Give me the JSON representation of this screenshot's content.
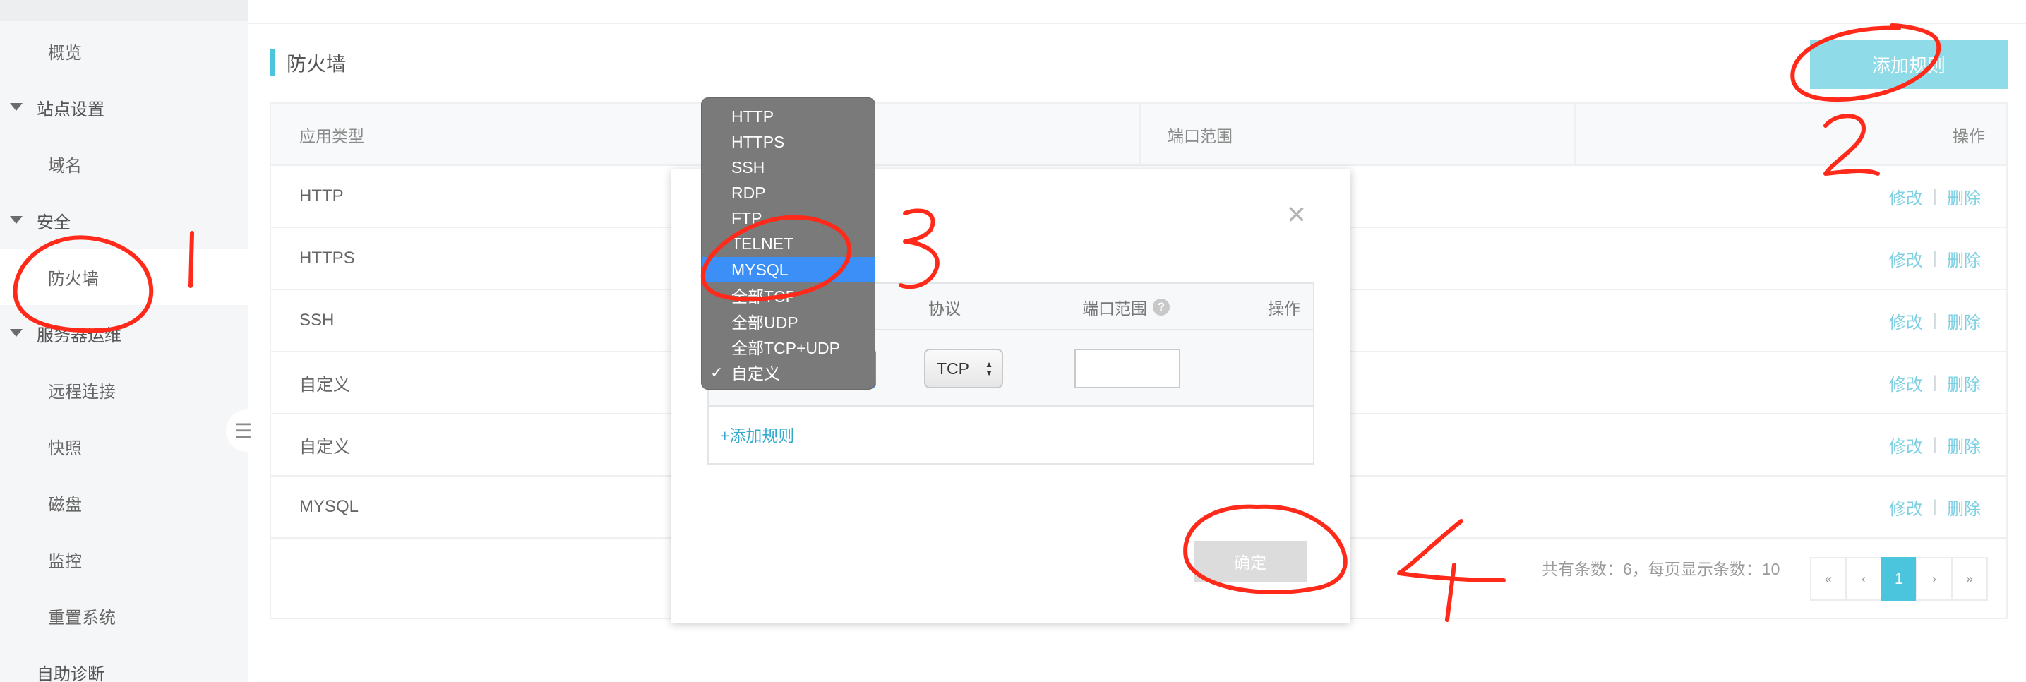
{
  "sidebar": {
    "items": [
      {
        "label": "概览"
      },
      {
        "label": "站点设置"
      },
      {
        "label": "域名"
      },
      {
        "label": "安全"
      },
      {
        "label": "防火墙"
      },
      {
        "label": "服务器运维"
      },
      {
        "label": "远程连接"
      },
      {
        "label": "快照"
      },
      {
        "label": "磁盘"
      },
      {
        "label": "监控"
      },
      {
        "label": "重置系统"
      },
      {
        "label": "自助诊断"
      }
    ],
    "collapse_icon": "☰"
  },
  "page": {
    "title": "防火墙",
    "add_rule_label": "添加规则"
  },
  "table": {
    "headers": {
      "type": "应用类型",
      "port": "端口范围",
      "ops": "操作"
    },
    "rows": [
      {
        "type": "HTTP"
      },
      {
        "type": "HTTPS"
      },
      {
        "type": "SSH"
      },
      {
        "type": "自定义"
      },
      {
        "type": "自定义"
      },
      {
        "type": "MYSQL"
      }
    ],
    "edit_label": "修改",
    "delete_label": "删除",
    "separator": "|"
  },
  "pagination": {
    "summary": "共有条数：6，每页显示条数：10",
    "first": "«",
    "prev": "‹",
    "current": "1",
    "next": "›",
    "last": "»"
  },
  "modal": {
    "close_icon": "×",
    "headers": {
      "protocol": "协议",
      "port": "端口范围",
      "ops": "操作"
    },
    "help_icon": "?",
    "protocol_value": "TCP",
    "add_rule_link": "+添加规则",
    "confirm_label": "确定"
  },
  "dropdown": {
    "options": [
      "HTTP",
      "HTTPS",
      "SSH",
      "RDP",
      "FTP",
      "TELNET",
      "MYSQL",
      "全部TCP",
      "全部UDP",
      "全部TCP+UDP",
      "自定义"
    ],
    "highlighted": "MYSQL",
    "checked": "自定义",
    "check_glyph": "✓"
  },
  "colors": {
    "accent": "#4bc5dd",
    "link": "#7fd0e3",
    "highlight": "#3c8ff6",
    "annotation": "#ff2a1a"
  }
}
